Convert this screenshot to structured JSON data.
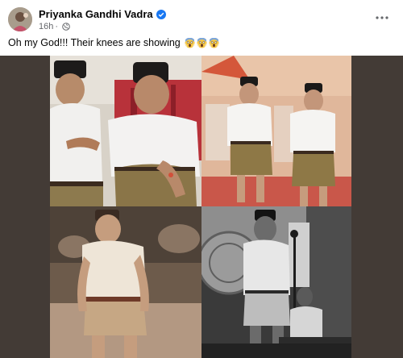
{
  "post": {
    "author": "Priyanka Gandhi Vadra",
    "timestamp": "16h",
    "caption": "Oh my God!!! Their knees are showing",
    "caption_emojis": [
      "face-screaming-in-fear",
      "face-screaming-in-fear",
      "face-screaming-in-fear"
    ],
    "icons": {
      "verified": "verified-badge-icon",
      "audience": "globe-icon",
      "more": "more-options-icon"
    }
  },
  "colors": {
    "verified_blue": "#1877f2",
    "text_primary": "#050505",
    "text_secondary": "#65676b",
    "media_backdrop": "#433b36"
  }
}
